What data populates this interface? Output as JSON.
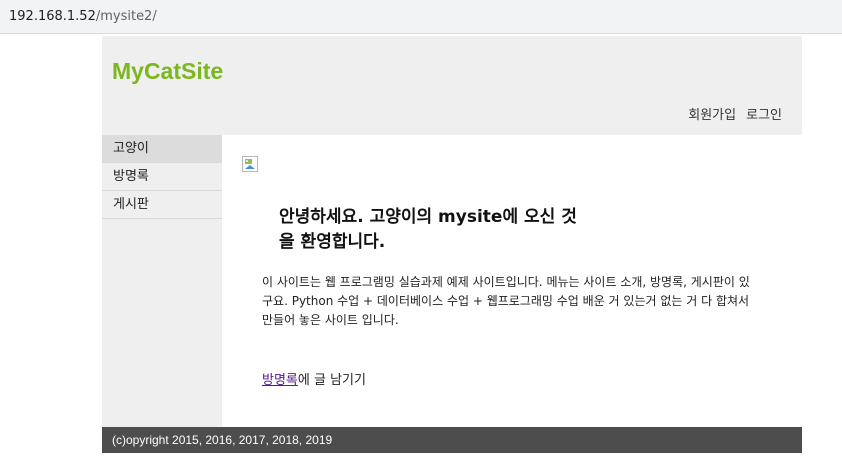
{
  "browser": {
    "url_host": "192.168.1.52",
    "url_path": "/mysite2/"
  },
  "header": {
    "logo": "MyCatSite",
    "signup_label": "회원가입",
    "login_label": "로그인"
  },
  "sidebar": {
    "items": [
      {
        "label": "고양이",
        "active": true
      },
      {
        "label": "방명록",
        "active": false
      },
      {
        "label": "게시판",
        "active": false
      }
    ]
  },
  "main": {
    "image_icon": "broken-image-icon",
    "welcome": "안녕하세요. 고양이의 mysite에 오신 것을 환영합니다.",
    "intro": "이 사이트는 웹 프로그램밍 실습과제 예제 사이트입니다. 메뉴는 사이트 소개, 방명록, 게시판이 있구요. Python 수업 + 데이터베이스 수업 + 웹프로그래밍 수업 배운 거 있는거 없는 거 다 합쳐서 만들어 놓은 사이트 입니다.",
    "guestbook_link": "방명록",
    "guestbook_suffix": "에 글 남기기"
  },
  "footer": {
    "copyright": "(c)opyright 2015, 2016, 2017, 2018, 2019"
  },
  "colors": {
    "logo": "#7bb71e",
    "header_bg": "#efefef",
    "footer_bg": "#4d4d4d",
    "link_visited": "#551a8b"
  }
}
